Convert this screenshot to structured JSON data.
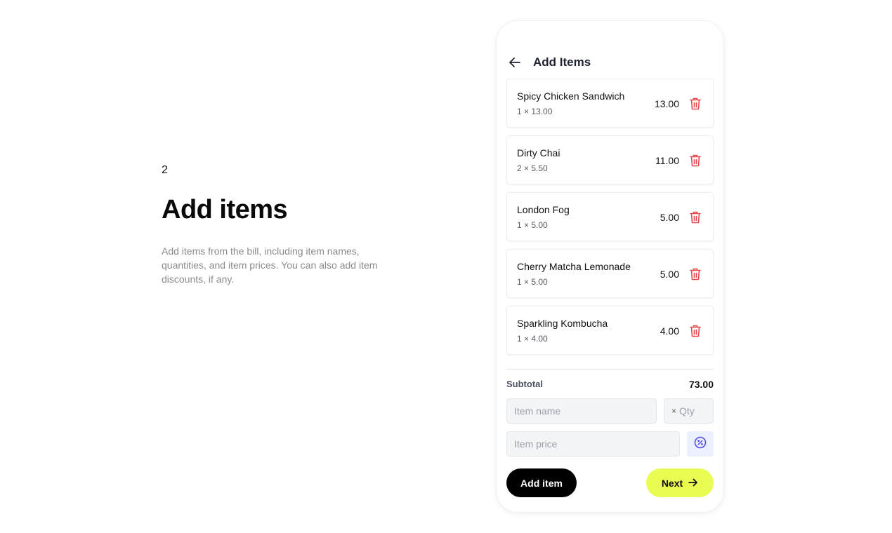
{
  "intro": {
    "step_number": "2",
    "heading": "Add items",
    "description": "Add items from the bill, including item names, quantities, and item prices. You can also add item discounts, if any."
  },
  "screen": {
    "title": "Add Items",
    "back_icon": "arrow-left-icon",
    "items": [
      {
        "name": "Spicy Chicken Sandwich",
        "qty_price": "1 × 13.00",
        "total": "13.00"
      },
      {
        "name": "Dirty Chai",
        "qty_price": "2 × 5.50",
        "total": "11.00"
      },
      {
        "name": "London Fog",
        "qty_price": "1 × 5.00",
        "total": "5.00"
      },
      {
        "name": "Cherry Matcha Lemonade",
        "qty_price": "1 × 5.00",
        "total": "5.00"
      },
      {
        "name": "Sparkling Kombucha",
        "qty_price": "1 × 4.00",
        "total": "4.00"
      }
    ],
    "subtotal_label": "Subtotal",
    "subtotal_value": "73.00",
    "form": {
      "item_name_placeholder": "Item name",
      "qty_prefix": "×",
      "qty_placeholder": "Qty",
      "item_price_placeholder": "Item price",
      "discount_icon": "percent-badge-icon"
    },
    "add_item_label": "Add item",
    "next_label": "Next"
  },
  "colors": {
    "trash": "#e5484d",
    "next_button": "#e9fc52",
    "discount_icon": "#4f46e5",
    "discount_bg": "#eceffe"
  }
}
